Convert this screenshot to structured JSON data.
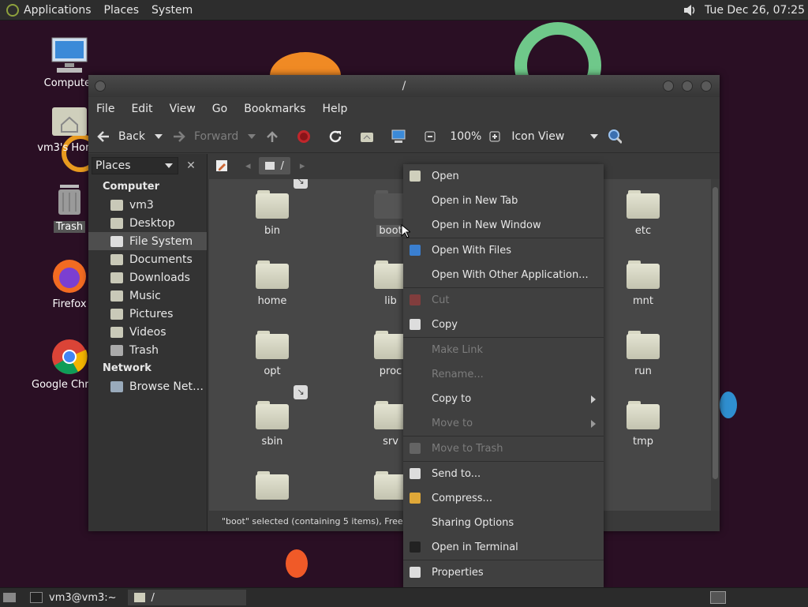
{
  "top_panel": {
    "menus": [
      "Applications",
      "Places",
      "System"
    ],
    "clock": "Tue Dec 26, 07:25",
    "volume_icon": "speaker-icon"
  },
  "desktop": {
    "icons": [
      {
        "label": "Computer",
        "icon": "computer-icon"
      },
      {
        "label": "vm3's Home",
        "icon": "home-folder-icon"
      },
      {
        "label": "Trash",
        "icon": "trash-icon"
      },
      {
        "label": "Firefox",
        "icon": "firefox-icon"
      },
      {
        "label": "Google Chrome",
        "icon": "chrome-icon"
      }
    ]
  },
  "window": {
    "title": "/",
    "menu": [
      "File",
      "Edit",
      "View",
      "Go",
      "Bookmarks",
      "Help"
    ],
    "toolbar": {
      "back": "Back",
      "forward": "Forward",
      "zoom": "100%",
      "view_mode": "Icon View"
    },
    "sidebar": {
      "selector": "Places",
      "computer_header": "Computer",
      "computer_items": [
        "vm3",
        "Desktop",
        "File System",
        "Documents",
        "Downloads",
        "Music",
        "Pictures",
        "Videos",
        "Trash"
      ],
      "selected": "File System",
      "network_header": "Network",
      "network_items": [
        "Browse Net…"
      ]
    },
    "pathbar": {
      "current": "/"
    },
    "files": [
      {
        "name": "bin",
        "link": true
      },
      {
        "name": "boot",
        "link": false
      },
      {
        "name": "etc",
        "link": false
      },
      {
        "name": "home",
        "link": false
      },
      {
        "name": "lib",
        "link": false
      },
      {
        "name": "mnt",
        "link": false
      },
      {
        "name": "opt",
        "link": false
      },
      {
        "name": "proc",
        "link": false
      },
      {
        "name": "run",
        "link": false
      },
      {
        "name": "sbin",
        "link": true
      },
      {
        "name": "srv",
        "link": false
      },
      {
        "name": "tmp",
        "link": false
      }
    ],
    "status": "\"boot\" selected (containing 5 items), Free space..."
  },
  "context_menu": {
    "items": [
      {
        "label": "Open",
        "icon": "folder-open-icon",
        "enabled": true
      },
      {
        "label": "Open in New Tab",
        "enabled": true
      },
      {
        "label": "Open in New Window",
        "enabled": true
      },
      {
        "sep": true
      },
      {
        "label": "Open With Files",
        "icon": "files-app-icon",
        "enabled": true
      },
      {
        "label": "Open With Other Application...",
        "enabled": true
      },
      {
        "sep": true
      },
      {
        "label": "Cut",
        "icon": "scissors-icon",
        "enabled": false
      },
      {
        "label": "Copy",
        "icon": "copy-icon",
        "enabled": true
      },
      {
        "sep": true
      },
      {
        "label": "Make Link",
        "enabled": false
      },
      {
        "label": "Rename...",
        "enabled": false
      },
      {
        "label": "Copy to",
        "enabled": true,
        "submenu": true
      },
      {
        "label": "Move to",
        "enabled": false,
        "submenu": true
      },
      {
        "sep": true
      },
      {
        "label": "Move to Trash",
        "icon": "trash-icon",
        "enabled": false
      },
      {
        "sep": true
      },
      {
        "label": "Send to...",
        "icon": "send-icon",
        "enabled": true
      },
      {
        "label": "Compress...",
        "icon": "archive-icon",
        "enabled": true
      },
      {
        "label": "Sharing Options",
        "enabled": true
      },
      {
        "label": "Open in Terminal",
        "icon": "terminal-icon",
        "enabled": true
      },
      {
        "sep": true
      },
      {
        "label": "Properties",
        "icon": "properties-icon",
        "enabled": true
      }
    ]
  },
  "bottom_panel": {
    "tasks": [
      {
        "label": "vm3@vm3:~",
        "icon": "terminal-icon"
      },
      {
        "label": "/",
        "icon": "folder-icon"
      }
    ]
  }
}
